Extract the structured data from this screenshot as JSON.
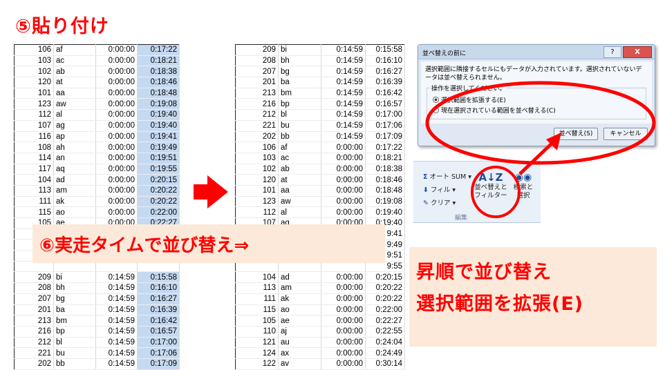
{
  "title": "⑤貼り付け",
  "left_sheet": {
    "rows": [
      [
        "106",
        "af",
        "0:00:00",
        "0:17:22"
      ],
      [
        "103",
        "ac",
        "0:00:00",
        "0:18:21"
      ],
      [
        "102",
        "ab",
        "0:00:00",
        "0:18:38"
      ],
      [
        "120",
        "at",
        "0:00:00",
        "0:18:46"
      ],
      [
        "101",
        "aa",
        "0:00:00",
        "0:18:48"
      ],
      [
        "123",
        "aw",
        "0:00:00",
        "0:19:08"
      ],
      [
        "112",
        "al",
        "0:00:00",
        "0:19:40"
      ],
      [
        "107",
        "ag",
        "0:00:00",
        "0:19:40"
      ],
      [
        "116",
        "ap",
        "0:00:00",
        "0:19:41"
      ],
      [
        "108",
        "ah",
        "0:00:00",
        "0:19:49"
      ],
      [
        "114",
        "an",
        "0:00:00",
        "0:19:51"
      ],
      [
        "117",
        "aq",
        "0:00:00",
        "0:19:55"
      ],
      [
        "104",
        "ad",
        "0:00:00",
        "0:20:15"
      ],
      [
        "113",
        "am",
        "0:00:00",
        "0:20:22"
      ],
      [
        "111",
        "ak",
        "0:00:00",
        "0:20:22"
      ],
      [
        "115",
        "ao",
        "0:00:00",
        "0:22:00"
      ],
      [
        "105",
        "ae",
        "0:00:00",
        "0:22:27"
      ],
      [
        "",
        "",
        "",
        ""
      ],
      [
        "",
        "",
        "",
        ""
      ],
      [
        "",
        "",
        "",
        ""
      ],
      [
        "",
        "",
        "",
        ""
      ],
      [
        "209",
        "bi",
        "0:14:59",
        "0:15:58"
      ],
      [
        "208",
        "bh",
        "0:14:59",
        "0:16:10"
      ],
      [
        "207",
        "bg",
        "0:14:59",
        "0:16:27"
      ],
      [
        "201",
        "ba",
        "0:14:59",
        "0:16:39"
      ],
      [
        "213",
        "bm",
        "0:14:59",
        "0:16:42"
      ],
      [
        "216",
        "bp",
        "0:14:59",
        "0:16:57"
      ],
      [
        "212",
        "bl",
        "0:14:59",
        "0:17:00"
      ],
      [
        "221",
        "bu",
        "0:14:59",
        "0:17:06"
      ],
      [
        "202",
        "bb",
        "0:14:59",
        "0:17:09"
      ]
    ]
  },
  "right_sheet": {
    "rows": [
      [
        "209",
        "bi",
        "0:14:59",
        "0:15:58"
      ],
      [
        "208",
        "bh",
        "0:14:59",
        "0:16:10"
      ],
      [
        "207",
        "bg",
        "0:14:59",
        "0:16:27"
      ],
      [
        "201",
        "ba",
        "0:14:59",
        "0:16:39"
      ],
      [
        "213",
        "bm",
        "0:14:59",
        "0:16:42"
      ],
      [
        "216",
        "bp",
        "0:14:59",
        "0:16:57"
      ],
      [
        "212",
        "bl",
        "0:14:59",
        "0:17:00"
      ],
      [
        "221",
        "bu",
        "0:14:59",
        "0:17:06"
      ],
      [
        "202",
        "bb",
        "0:14:59",
        "0:17:09"
      ],
      [
        "106",
        "af",
        "0:00:00",
        "0:17:22"
      ],
      [
        "103",
        "ac",
        "0:00:00",
        "0:18:21"
      ],
      [
        "102",
        "ab",
        "0:00:00",
        "0:18:38"
      ],
      [
        "120",
        "at",
        "0:00:00",
        "0:18:46"
      ],
      [
        "101",
        "aa",
        "0:00:00",
        "0:18:48"
      ],
      [
        "123",
        "aw",
        "0:00:00",
        "0:19:08"
      ],
      [
        "112",
        "al",
        "0:00:00",
        "0:19:40"
      ],
      [
        "107",
        "ag",
        "0:00:00",
        "0:19:40"
      ],
      [
        "",
        "",
        "",
        "9:41"
      ],
      [
        "",
        "",
        "",
        "9:49"
      ],
      [
        "",
        "",
        "",
        "9:51"
      ],
      [
        "",
        "",
        "",
        "9:55"
      ],
      [
        "104",
        "ad",
        "0:00:00",
        "0:20:15"
      ],
      [
        "113",
        "am",
        "0:00:00",
        "0:20:22"
      ],
      [
        "111",
        "ak",
        "0:00:00",
        "0:20:22"
      ],
      [
        "115",
        "ao",
        "0:00:00",
        "0:22:00"
      ],
      [
        "105",
        "ae",
        "0:00:00",
        "0:22:27"
      ],
      [
        "110",
        "aj",
        "0:00:00",
        "0:22:55"
      ],
      [
        "121",
        "au",
        "0:00:00",
        "0:24:04"
      ],
      [
        "124",
        "ax",
        "0:00:00",
        "0:24:49"
      ],
      [
        "122",
        "av",
        "0:00:00",
        "0:30:14"
      ]
    ]
  },
  "banner6": "⑥実走タイムで並び替え⇒",
  "note": {
    "line1": "昇順で並び替え",
    "line2": "選択範囲を拡張(E)"
  },
  "dialog": {
    "title": "並べ替えの前に",
    "help": "?",
    "close": "X",
    "message": "選択範囲に隣接するセルにもデータが入力されています。選択されていないデータは並べ替えられません。",
    "group_label": "操作を選択してください。",
    "option1": "選択範囲を拡張する(E)",
    "option2": "現在選択されている範囲を並べ替える(C)",
    "ok": "並べ替え(S)",
    "cancel": "キャンセル"
  },
  "ribbon": {
    "autosum": "オート SUM",
    "fill": "フィル",
    "clear": "クリア",
    "sort_filter_1": "並べ替えと",
    "sort_filter_2": "フィルター",
    "find_1": "検索と",
    "find_2": "選択",
    "group": "編集"
  },
  "colors": {
    "accent_red": "#ff0000",
    "selection_blue": "#c5d9f1",
    "banner_bg": "#fde9d9"
  }
}
